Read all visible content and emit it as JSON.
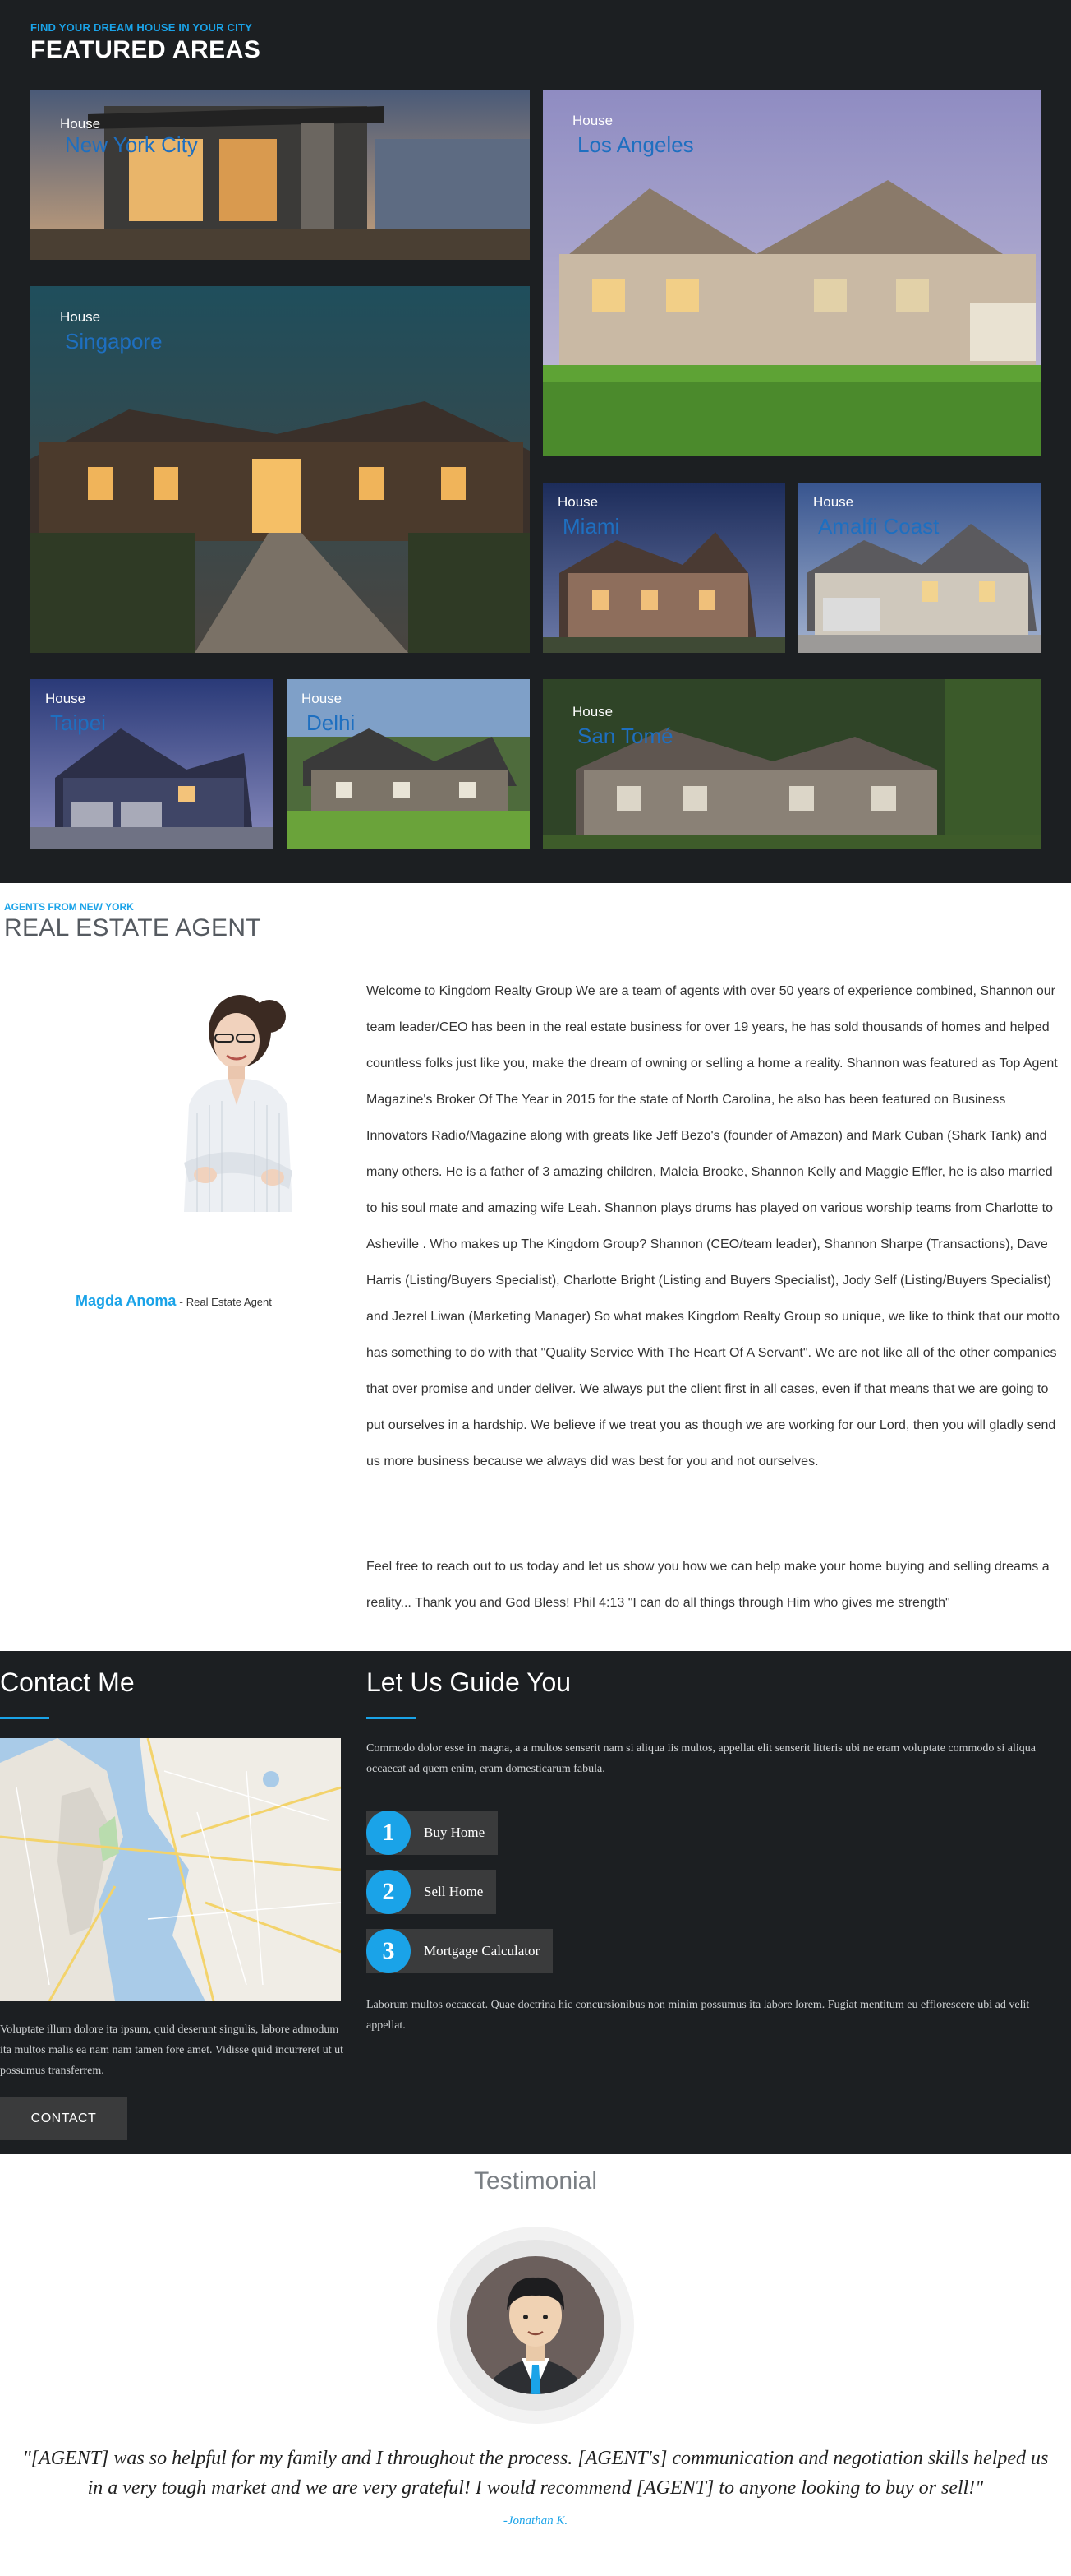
{
  "featured": {
    "kicker": "FIND YOUR DREAM HOUSE IN YOUR CITY",
    "title": "FEATURED AREAS",
    "tiles": [
      {
        "type": "House",
        "city": "New York City"
      },
      {
        "type": "House",
        "city": "Los Angeles"
      },
      {
        "type": "House",
        "city": "Singapore"
      },
      {
        "type": "House",
        "city": "Miami"
      },
      {
        "type": "House",
        "city": "Amalfi Coast"
      },
      {
        "type": "House",
        "city": "Taipei"
      },
      {
        "type": "House",
        "city": "Delhi"
      },
      {
        "type": "House",
        "city": "San Tomé"
      }
    ]
  },
  "agent": {
    "kicker": "AGENTS FROM NEW YORK",
    "title": "REAL ESTATE AGENT",
    "name": "Magda Anoma",
    "dash": " - ",
    "role": "Real Estate Agent",
    "bio": "Welcome to Kingdom Realty Group We are a team of agents with over 50 years of experience combined, Shannon our team leader/CEO has been in the real estate business for over 19 years, he has sold thousands of homes and helped countless folks just like you, make the dream of owning or selling a home a reality. Shannon was featured as Top Agent Magazine's Broker Of The Year in 2015 for the state of North Carolina, he also has been featured on Business Innovators Radio/Magazine along with greats like Jeff Bezo's (founder of Amazon) and Mark Cuban (Shark Tank) and many others. He is a father of 3 amazing children, Maleia Brooke, Shannon Kelly and Maggie Effler, he is also married to his soul mate and amazing wife Leah. Shannon plays drums has played on various worship teams from Charlotte to Asheville . Who makes up The Kingdom Group? Shannon (CEO/team leader), Shannon Sharpe (Transactions), Dave Harris (Listing/Buyers Specialist), Charlotte Bright (Listing and Buyers Specialist), Jody Self (Listing/Buyers Specialist) and Jezrel Liwan (Marketing Manager) So what makes Kingdom Realty Group so unique, we like to think that our motto has something to do with that \"Quality Service With The Heart Of A Servant\". We are not like all of the other companies that over promise and under deliver. We always put the client first in all cases, even if that means that we are going to put ourselves in a hardship. We believe if we treat you as though we are working for our Lord, then you will gladly send us more business because we always did was best for you and not ourselves.",
    "bio2": "Feel free to reach out to us today and let us show you how we can help make your home buying and selling dreams a reality... Thank you and God Bless! Phil 4:13 \"I can do all things through Him who gives me strength\""
  },
  "contact": {
    "title": "Contact Me",
    "text": "Voluptate illum dolore ita ipsum, quid deserunt singulis, labore admodum ita multos malis ea nam nam tamen fore amet. Vidisse quid incurreret ut ut possumus transferrem.",
    "button": "CONTACT",
    "accent": "#1aa3e8"
  },
  "guide": {
    "title": "Let Us Guide You",
    "text": "Commodo dolor esse in magna, a a multos senserit nam si aliqua iis multos, appellat elit senserit litteris ubi ne eram voluptate commodo si aliqua occaecat ad quem enim, eram domesticarum fabula.",
    "steps": [
      {
        "num": "1",
        "label": "Buy Home"
      },
      {
        "num": "2",
        "label": "Sell Home"
      },
      {
        "num": "3",
        "label": "Mortgage Calculator"
      }
    ],
    "text2": "Laborum multos occaecat. Quae doctrina hic concursionibus non minim possumus ita labore lorem. Fugiat mentitum eu efflorescere ubi ad velit appellat."
  },
  "testimonial": {
    "title": "Testimonial",
    "quote": "\"[AGENT] was so helpful for my family and I throughout the process. [AGENT's] communication and negotiation skills helped us in a very tough market and we are very grateful! I would recommend [AGENT] to anyone looking to buy or sell!\"",
    "author": "-Jonathan K."
  }
}
